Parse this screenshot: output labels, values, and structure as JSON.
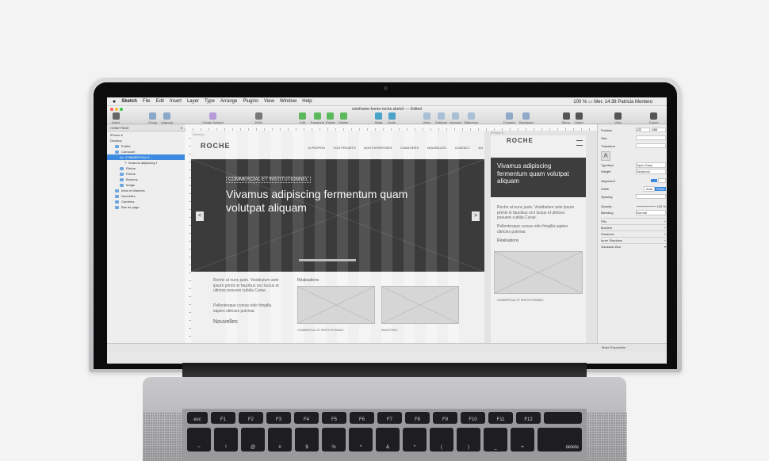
{
  "menubar": {
    "apple": "",
    "app": "Sketch",
    "items": [
      "File",
      "Edit",
      "Insert",
      "Layer",
      "Type",
      "Arrange",
      "Plugins",
      "View",
      "Window",
      "Help"
    ],
    "status_right": "100 % ▭  Mer. 14:38  Patricia Montero"
  },
  "window": {
    "title": "wireframe-home-roche.sketch — Edited",
    "page_select": "HOME PAGE"
  },
  "toolbar": {
    "items": [
      "Insert",
      "Group",
      "Ungroup",
      "Create Symbol",
      "100%",
      "Edit",
      "Transform",
      "Rotate",
      "Flatten",
      "Mask",
      "Scale",
      "Union",
      "Subtract",
      "Intersect",
      "Difference",
      "Forward",
      "Backward",
      "Mirror",
      "Share",
      "View",
      "Export"
    ]
  },
  "layers": [
    {
      "label": "iPhone 6",
      "level": 0
    },
    {
      "label": "Desktop",
      "level": 0
    },
    {
      "label": "Entête",
      "level": 1
    },
    {
      "label": "Carrousel",
      "level": 1
    },
    {
      "label": "Ac. COMMERCIAL E...",
      "level": 2,
      "selected": true
    },
    {
      "label": "Vivamus adipiscing f",
      "level": 3
    },
    {
      "label": "Flèche",
      "level": 2
    },
    {
      "label": "Flèche",
      "level": 2
    },
    {
      "label": "Boutons",
      "level": 2
    },
    {
      "label": "Image",
      "level": 2
    },
    {
      "label": "Infos et Marchés",
      "level": 1
    },
    {
      "label": "Nouvelles",
      "level": 1
    },
    {
      "label": "Carrières",
      "level": 1
    },
    {
      "label": "Bas de page",
      "level": 1
    }
  ],
  "canvas": {
    "artboard_label": "Desktop",
    "mobile_label": "iPhone 6",
    "logo": "ROCHE",
    "nav": [
      "À PROPOS",
      "VOS PROJETS",
      "NOS EXPERTISES",
      "CHANTIERS",
      "NOUVELLES",
      "CONTACT",
      "EN"
    ],
    "hero_kicker": "COMMERCIAL ET INSTITUTIONNEL",
    "hero_title": "Vivamus adipiscing fermentum quam volutpat aliquam",
    "intro_text": "Roche at nunc justo. Vestibulum ante ipsum primis in faucibus orci luctus et ultrices posuere cubilia Curae.",
    "intro_text2": "Pellentesque cursus odio fringilla sapien ultricies pulvinar.",
    "nouvelles": "Nouvelles",
    "realisations": "Réalisations",
    "cap1": "COMMERCIAL ET INSTITUTIONNEL",
    "cap2": "INDUSTRIEL",
    "mobile_title": "Vivamus adipiscing fermentum quam volutpat aliquam",
    "mobile_text": "Roche at nunc justo. Vestibulum ante ipsum primis in faucibus orci luctus et ultrices posuere cubilia Curae.",
    "mobile_text2": "Pellentesque cursus odio fringilla sapien ultricies pulvinar.",
    "mobile_realisations": "Réalisations",
    "mobile_cap": "COMMERCIAL ET INSTITUTIONNEL"
  },
  "inspector": {
    "position": "Position",
    "pos_x": "122",
    "pos_y": "168",
    "size": "Size",
    "transform": "Transform",
    "typeface": "Typeface",
    "typeface_val": "Open Sans",
    "weight": "Weight",
    "weight_val": "Semibold",
    "alignment": "Alignment",
    "width": "Width",
    "width_auto": "Auto",
    "width_fixed": "Fixed",
    "spacing": "Spacing",
    "opacity": "Opacity",
    "opacity_val": "100 %",
    "blending": "Blending",
    "blending_val": "Normal",
    "fills": "Fills",
    "borders": "Borders",
    "shadows": "Shadows",
    "inner_shadows": "Inner Shadows",
    "gaussian_blur": "Gaussian Blur",
    "make_exportable": "Make Exportable"
  },
  "colors": {
    "selection": "#3d8be0",
    "hero_bg": "#3b3b3b",
    "folder": "#6fa6e0"
  },
  "keyboard": {
    "row1": [
      "esc",
      "F1",
      "F2",
      "F3",
      "F4",
      "F5",
      "F6",
      "F7",
      "F8",
      "F9",
      "F10",
      "F11",
      "F12"
    ],
    "row2": [
      "~",
      "!",
      "@",
      "#",
      "$",
      "%",
      "^",
      "&",
      "*",
      "(",
      ")",
      "_",
      "+",
      "delete"
    ]
  }
}
